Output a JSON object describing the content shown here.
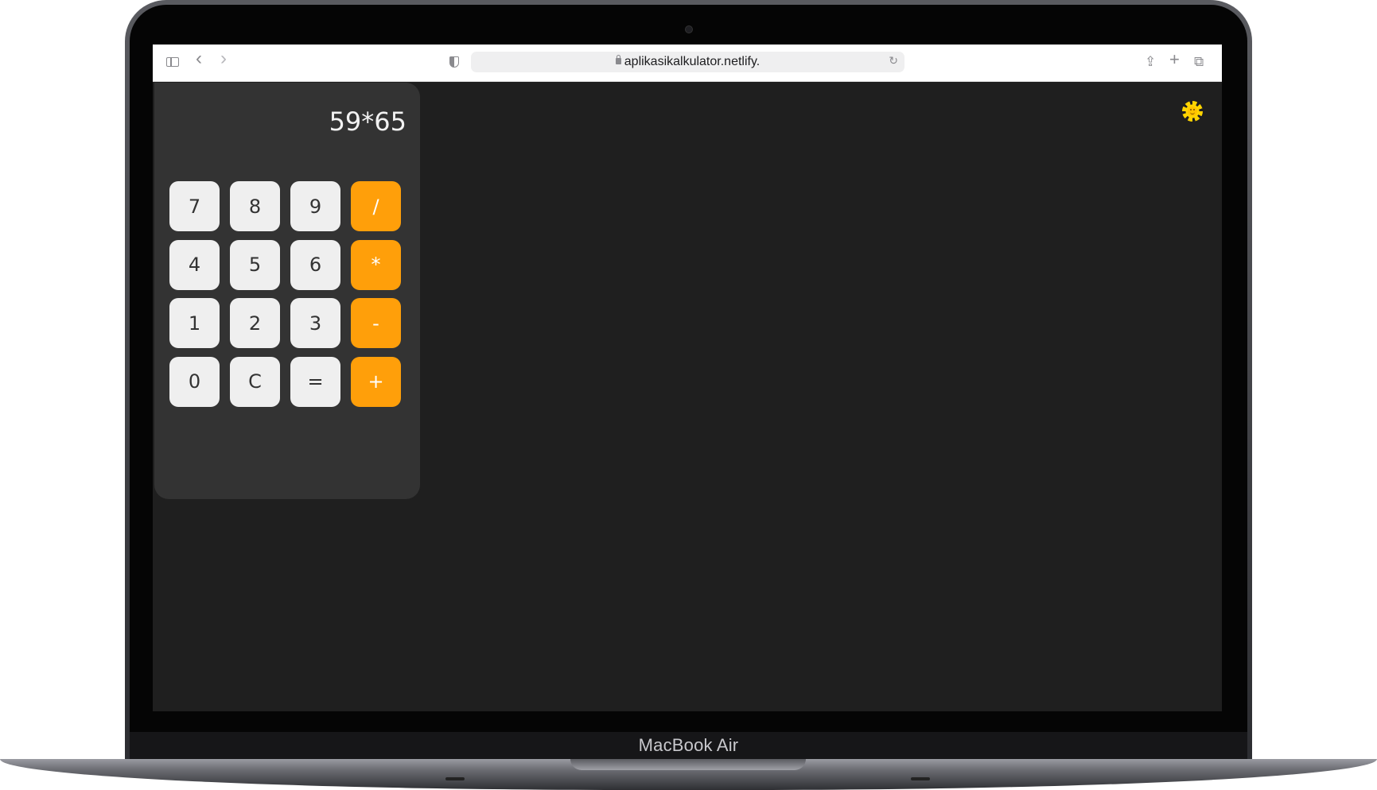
{
  "browser": {
    "url": "aplikasikalkulator.netlify.",
    "icons": {
      "sidebar": "sidebar-icon",
      "back": "‹",
      "forward": "›",
      "privacy": "shield-icon",
      "lock": "lock-icon",
      "reload": "↻",
      "share": "⇪",
      "new_tab": "+",
      "tabs": "⧉"
    }
  },
  "calculator": {
    "display": "59*65",
    "keys": [
      {
        "label": "7",
        "type": "digit"
      },
      {
        "label": "8",
        "type": "digit"
      },
      {
        "label": "9",
        "type": "digit"
      },
      {
        "label": "/",
        "type": "operator"
      },
      {
        "label": "4",
        "type": "digit"
      },
      {
        "label": "5",
        "type": "digit"
      },
      {
        "label": "6",
        "type": "digit"
      },
      {
        "label": "*",
        "type": "operator"
      },
      {
        "label": "1",
        "type": "digit"
      },
      {
        "label": "2",
        "type": "digit"
      },
      {
        "label": "3",
        "type": "digit"
      },
      {
        "label": "-",
        "type": "operator"
      },
      {
        "label": "0",
        "type": "digit"
      },
      {
        "label": "C",
        "type": "clear"
      },
      {
        "label": "=",
        "type": "equals"
      },
      {
        "label": "+",
        "type": "operator"
      }
    ],
    "colors": {
      "panel": "#333333",
      "key": "#efefef",
      "operator": "#ff9f0a",
      "page_background": "#1f1f1f"
    }
  },
  "theme_toggle": {
    "icon": "sun-icon"
  },
  "device": {
    "label": "MacBook Air"
  }
}
